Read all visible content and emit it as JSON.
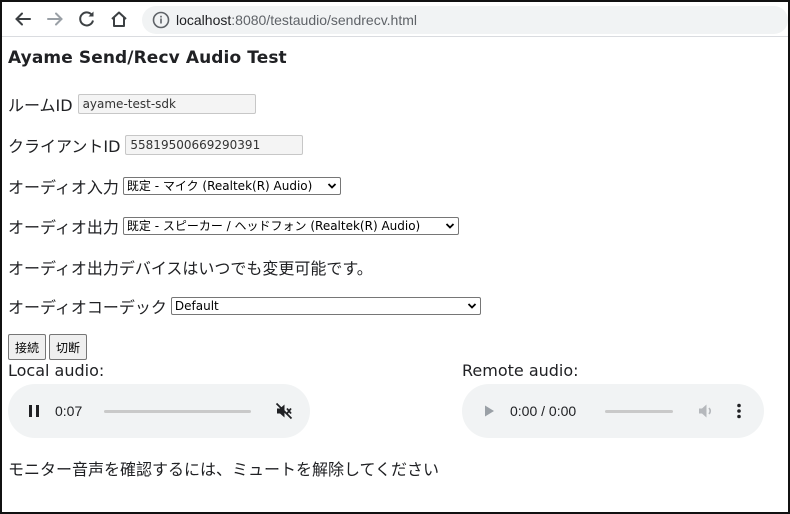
{
  "browser": {
    "url_host": "localhost",
    "url_path": ":8080/testaudio/sendrecv.html"
  },
  "page": {
    "title": "Ayame Send/Recv Audio Test",
    "room_id_label": "ルームID",
    "room_id_value": "ayame-test-sdk",
    "client_id_label": "クライアントID",
    "client_id_value": "55819500669290391",
    "audio_input_label": "オーディオ入力",
    "audio_input_selected": "既定 - マイク (Realtek(R) Audio)",
    "audio_output_label": "オーディオ出力",
    "audio_output_selected": "既定 - スピーカー / ヘッドフォン (Realtek(R) Audio)",
    "output_note": "オーディオ出力デバイスはいつでも変更可能です。",
    "codec_label": "オーディオコーデック",
    "codec_selected": "Default",
    "connect_label": "接続",
    "disconnect_label": "切断",
    "local_audio_label": "Local audio:",
    "remote_audio_label": "Remote audio:",
    "monitor_note": "モニター音声を確認するには、ミュートを解除してください"
  },
  "local_player": {
    "time": "0:07",
    "state": "playing",
    "muted": true,
    "progress": 0
  },
  "remote_player": {
    "time": "0:00 / 0:00",
    "state": "disabled"
  }
}
